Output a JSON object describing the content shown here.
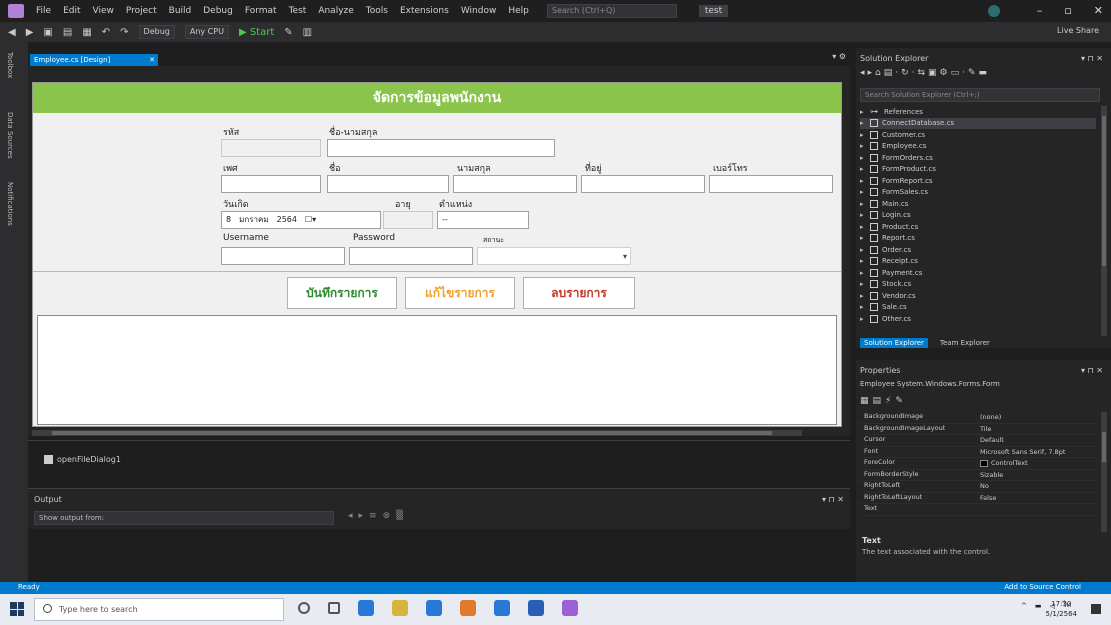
{
  "menubar": {
    "items": [
      "File",
      "Edit",
      "View",
      "Project",
      "Build",
      "Debug",
      "Format",
      "Test",
      "Analyze",
      "Tools",
      "Extensions",
      "Window",
      "Help"
    ],
    "search_placeholder": "Search (Ctrl+Q)",
    "solution_name": "test"
  },
  "toolbar": {
    "config": "Debug",
    "platform": "Any CPU",
    "start_label": "Start",
    "liveshare": "Live Share"
  },
  "left_strip": {
    "tabs": [
      "Toolbox",
      "Data Sources",
      "Notifications"
    ]
  },
  "document_tab": {
    "title": "Employee.cs [Design]"
  },
  "form": {
    "header": "จัดการข้อมูลพนักงาน",
    "labels": {
      "emp_id": "รหัส",
      "username_th": "ชื่อ-นามสกุล",
      "sex": "เพศ",
      "name": "ชื่อ",
      "lastname": "นามสกุล",
      "address": "ที่อยู่",
      "phone": "เบอร์โทร",
      "birthdate": "วันเกิด",
      "age": "อายุ",
      "position": "ตำแหน่ง",
      "username": "Username",
      "password": "Password",
      "status": "สถานะ"
    },
    "values": {
      "birth_day": "8",
      "birth_month": "มกราคม",
      "birth_year": "2564",
      "birth_dropdown": "☐▾",
      "position_value": "--"
    },
    "buttons": {
      "save": "บันทึกรายการ",
      "edit": "แก้ไขรายการ",
      "delete": "ลบรายการ"
    },
    "button_colors": {
      "save": "#2e8b2e",
      "edit": "#f0a030",
      "delete": "#c0392b"
    }
  },
  "tray": {
    "component": "openFileDialog1"
  },
  "output": {
    "title": "Output",
    "source_label": "Show output from:"
  },
  "solution_explorer": {
    "title": "Solution Explorer",
    "search_placeholder": "Search Solution Explorer (Ctrl+;)",
    "items": [
      {
        "label": "References",
        "icon": "ref",
        "selected": false
      },
      {
        "label": "ConnectDatabase.cs",
        "icon": "file",
        "selected": true
      },
      {
        "label": "Customer.cs",
        "icon": "file",
        "selected": false
      },
      {
        "label": "Employee.cs",
        "icon": "file",
        "selected": false
      },
      {
        "label": "FormOrders.cs",
        "icon": "file",
        "selected": false
      },
      {
        "label": "FormProduct.cs",
        "icon": "file",
        "selected": false
      },
      {
        "label": "FormReport.cs",
        "icon": "file",
        "selected": false
      },
      {
        "label": "FormSales.cs",
        "icon": "file",
        "selected": false
      },
      {
        "label": "Main.cs",
        "icon": "file",
        "selected": false
      },
      {
        "label": "Login.cs",
        "icon": "file",
        "selected": false
      },
      {
        "label": "Product.cs",
        "icon": "file",
        "selected": false
      },
      {
        "label": "Report.cs",
        "icon": "file",
        "selected": false
      },
      {
        "label": "Order.cs",
        "icon": "file",
        "selected": false
      },
      {
        "label": "Receipt.cs",
        "icon": "file",
        "selected": false
      },
      {
        "label": "Payment.cs",
        "icon": "file",
        "selected": false
      },
      {
        "label": "Stock.cs",
        "icon": "file",
        "selected": false
      },
      {
        "label": "Vendor.cs",
        "icon": "file",
        "selected": false
      },
      {
        "label": "Sale.cs",
        "icon": "file",
        "selected": false
      },
      {
        "label": "Other.cs",
        "icon": "file",
        "selected": false
      }
    ],
    "tabs": [
      "Solution Explorer",
      "Team Explorer"
    ]
  },
  "properties": {
    "title": "Properties",
    "object": "Employee System.Windows.Forms.Form",
    "rows": [
      {
        "name": "BackgroundImage",
        "value": "(none)"
      },
      {
        "name": "BackgroundImageLayout",
        "value": "Tile"
      },
      {
        "name": "Cursor",
        "value": "Default"
      },
      {
        "name": "Font",
        "value": "Microsoft Sans Serif, 7.8pt"
      },
      {
        "name": "ForeColor",
        "value": "ControlText"
      },
      {
        "name": "FormBorderStyle",
        "value": "Sizable"
      },
      {
        "name": "RightToLeft",
        "value": "No"
      },
      {
        "name": "RightToLeftLayout",
        "value": "False"
      },
      {
        "name": "Text",
        "value": ""
      }
    ],
    "desc_title": "Text",
    "desc_text": "The text associated with the control."
  },
  "statusbar": {
    "left": "Ready",
    "right": "Add to Source Control"
  },
  "taskbar": {
    "search_placeholder": "Type here to search",
    "time": "17:30",
    "date": "5/1/2564",
    "app_colors": [
      "#555555",
      "#555555",
      "#2a78d6",
      "#d8b43a",
      "#2a78d6",
      "#e07a2a",
      "#2a78d6",
      "#2a5fb8",
      "#9b5fd6"
    ]
  }
}
